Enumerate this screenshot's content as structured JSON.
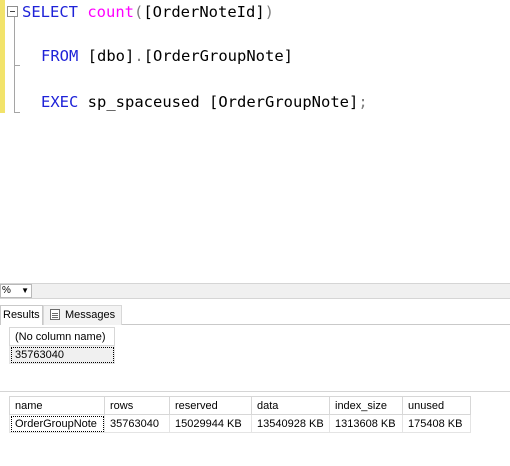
{
  "editor": {
    "lines": [
      {
        "parts": [
          {
            "t": "SELECT ",
            "c": "kw"
          },
          {
            "t": "count",
            "c": "fn"
          },
          {
            "t": "(",
            "c": "gr"
          },
          {
            "t": "[OrderNoteId]",
            "c": "id"
          },
          {
            "t": ")",
            "c": "gr"
          }
        ]
      },
      {
        "parts": [
          {
            "t": "FROM ",
            "c": "kw"
          },
          {
            "t": "[dbo]",
            "c": "id"
          },
          {
            "t": ".",
            "c": "gr"
          },
          {
            "t": "[OrderGroupNote]",
            "c": "id"
          }
        ]
      },
      {
        "parts": [
          {
            "t": "EXEC ",
            "c": "kw"
          },
          {
            "t": "sp_spaceused ",
            "c": "id"
          },
          {
            "t": "[OrderGroupNote]",
            "c": "id"
          },
          {
            "t": ";",
            "c": "gr"
          }
        ]
      }
    ],
    "icons": {
      "collapse": "collapse-minus-icon"
    }
  },
  "zoom": {
    "value": "%"
  },
  "tabs": {
    "results": "Results",
    "messages": "Messages"
  },
  "grid1": {
    "headers": [
      "(No column name)"
    ],
    "rows": [
      [
        "35763040"
      ]
    ]
  },
  "grid2": {
    "headers": [
      "name",
      "rows",
      "reserved",
      "data",
      "index_size",
      "unused"
    ],
    "rows": [
      [
        "OrderGroupNote",
        "35763040",
        "15029944 KB",
        "13540928 KB",
        "1313608 KB",
        "175408 KB"
      ]
    ]
  },
  "colors": {
    "keyword": "#1e22d8",
    "function": "#ff00ff",
    "operator": "#7f7f7f",
    "margin": "#f2e36a"
  }
}
